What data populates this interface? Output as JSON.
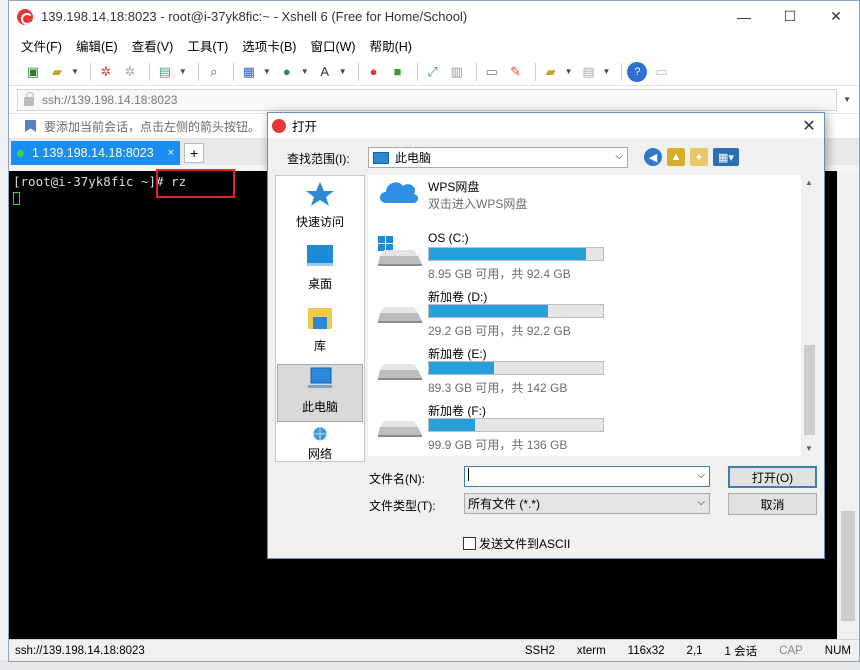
{
  "window": {
    "title": "139.198.14.18:8023 - root@i-37yk8fic:~ - Xshell 6 (Free for Home/School)",
    "min": "—",
    "max": "☐",
    "close": "✕"
  },
  "menu": [
    "文件(F)",
    "编辑(E)",
    "查看(V)",
    "工具(T)",
    "选项卡(B)",
    "窗口(W)",
    "帮助(H)"
  ],
  "address": {
    "value": "ssh://139.198.14.18:8023"
  },
  "hint": {
    "text": "要添加当前会话，点击左侧的箭头按钮。"
  },
  "tab": {
    "label": "1 139.198.14.18:8023",
    "close": "×",
    "add": "+"
  },
  "terminal": {
    "prompt": "[root@i-37yk8fic ~]# rz"
  },
  "statusbar": {
    "path": "ssh://139.198.14.18:8023",
    "protocol": "SSH2",
    "term": "xterm",
    "size": "116x32",
    "pos": "2,1",
    "sessions": "1 会话",
    "cap": "CAP",
    "num": "NUM"
  },
  "dialog": {
    "title": "打开",
    "close": "✕",
    "lookin_label": "查找范围(I):",
    "lookin_value": "此电脑",
    "places": [
      {
        "label": "快速访问",
        "icon": "star-icon"
      },
      {
        "label": "桌面",
        "icon": "desktop-icon"
      },
      {
        "label": "库",
        "icon": "library-icon"
      },
      {
        "label": "此电脑",
        "icon": "computer-icon"
      },
      {
        "label": "网络",
        "icon": "network-icon"
      }
    ],
    "wps": {
      "name": "WPS网盘",
      "sub": "双击进入WPS网盘"
    },
    "drives": [
      {
        "name": "OS (C:)",
        "space": "8.95 GB 可用，共 92.4 GB",
        "used_fraction": 0.903
      },
      {
        "name": "新加卷 (D:)",
        "space": "29.2 GB 可用，共 92.2 GB",
        "used_fraction": 0.683
      },
      {
        "name": "新加卷 (E:)",
        "space": "89.3 GB 可用，共 142 GB",
        "used_fraction": 0.371
      },
      {
        "name": "新加卷 (F:)",
        "space": "99.9 GB 可用，共 136 GB",
        "used_fraction": 0.265
      }
    ],
    "filename_label": "文件名(N):",
    "filename_value": "",
    "filetype_label": "文件类型(T):",
    "filetype_value": "所有文件 (*.*)",
    "open_button": "打开(O)",
    "cancel_button": "取消",
    "ascii_label": "发送文件到ASCII"
  }
}
